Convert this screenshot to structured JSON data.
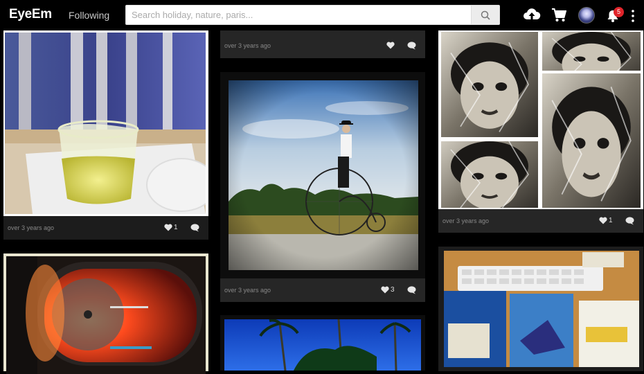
{
  "header": {
    "logo": "EyeEm",
    "nav_following": "Following",
    "search_placeholder": "Search holiday, nature, paris...",
    "notification_count": "5"
  },
  "cards": [
    {
      "id": "juice",
      "timestamp": "over 3 years ago",
      "likes": "1"
    },
    {
      "id": "top-strip",
      "timestamp": "over 3 years ago",
      "likes": ""
    },
    {
      "id": "bicycle",
      "timestamp": "over 3 years ago",
      "likes": "3"
    },
    {
      "id": "faces",
      "timestamp": "over 3 years ago",
      "likes": "1"
    }
  ]
}
